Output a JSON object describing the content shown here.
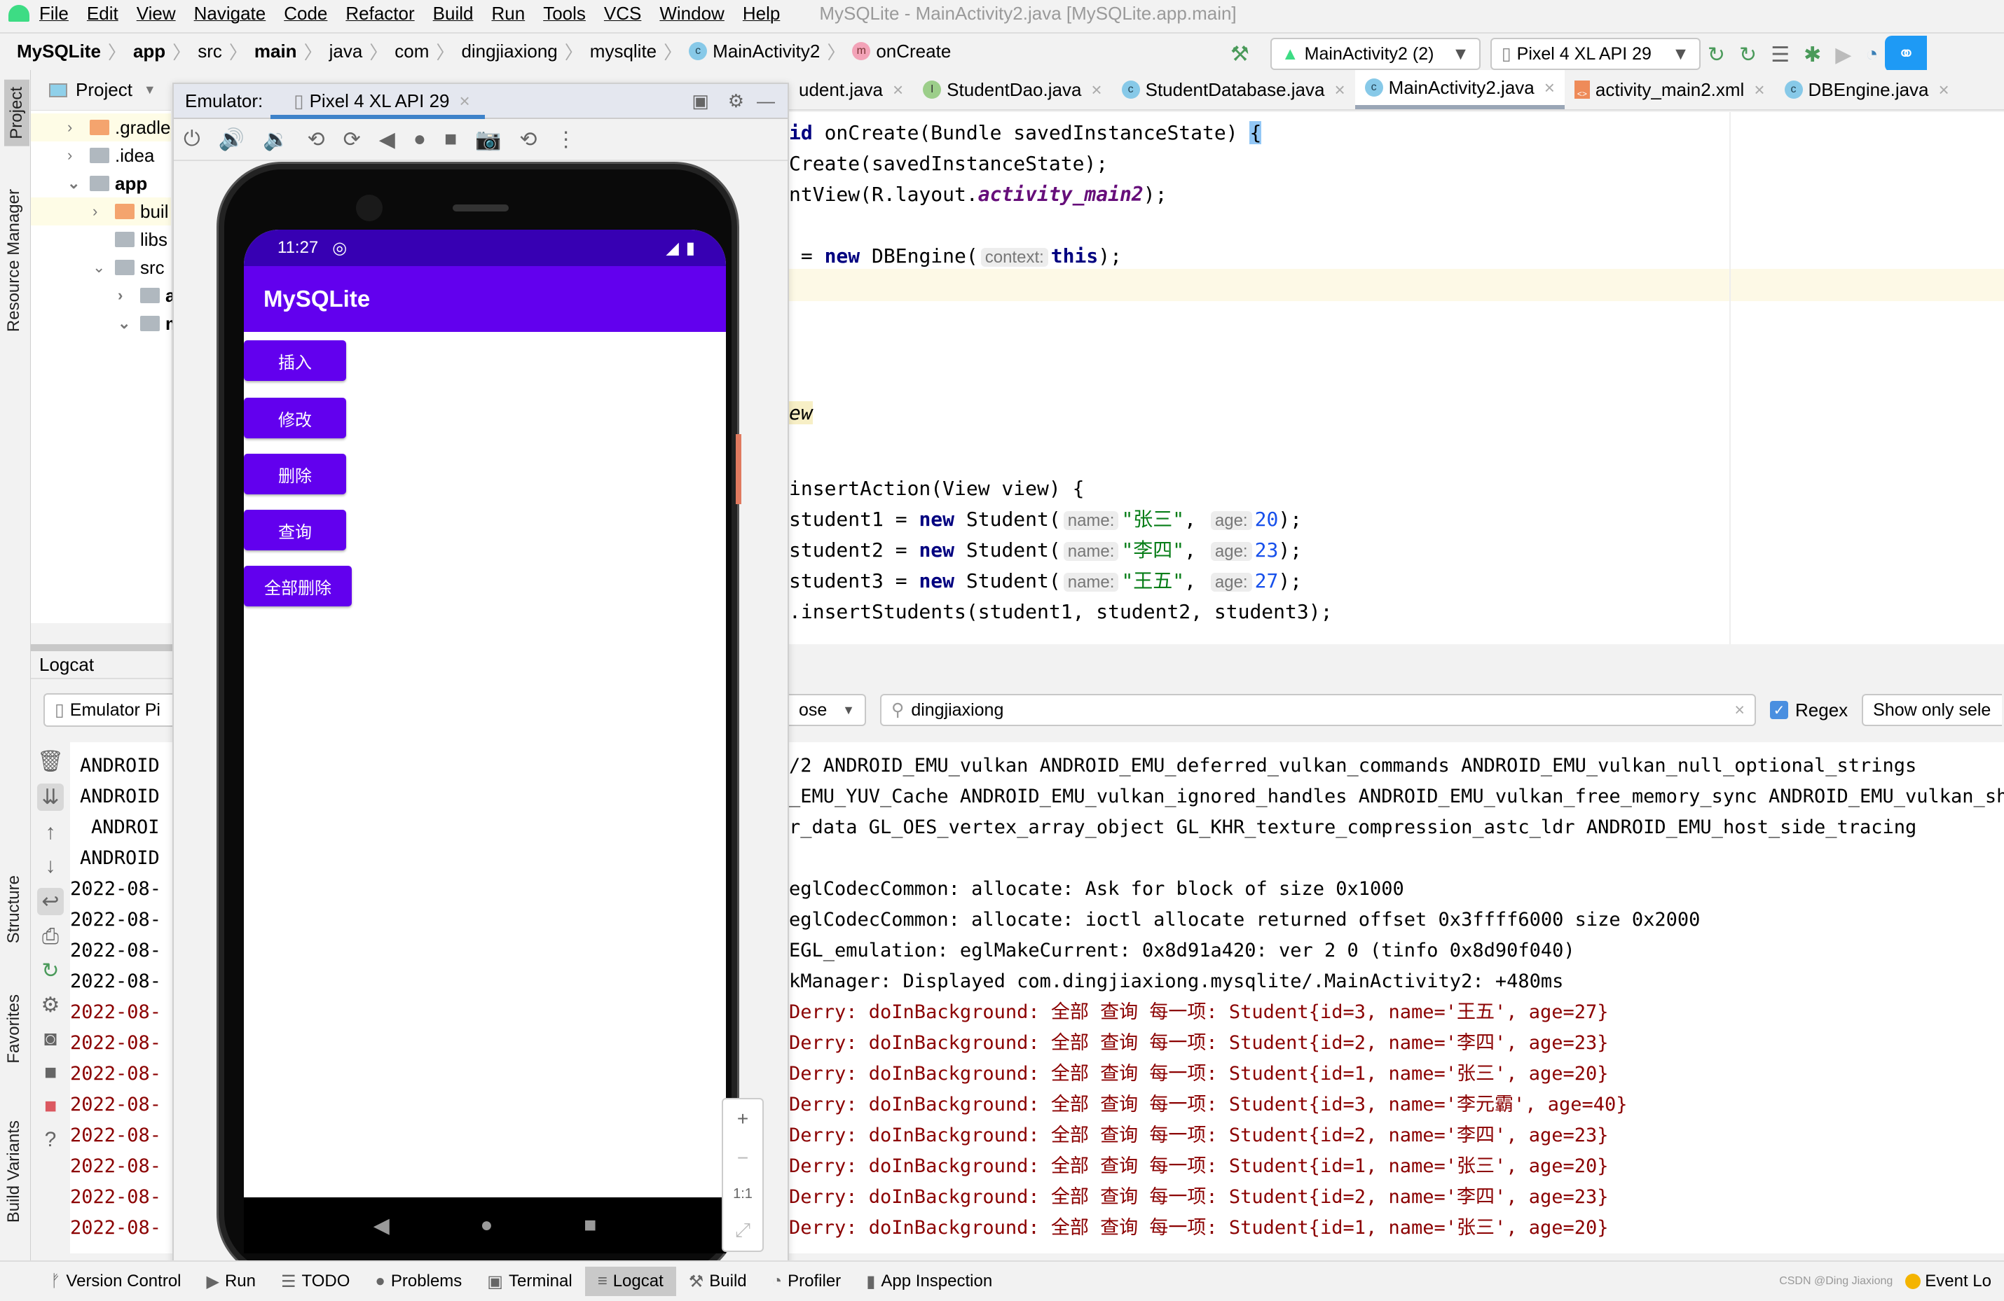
{
  "menubar": {
    "items": [
      "File",
      "Edit",
      "View",
      "Navigate",
      "Code",
      "Refactor",
      "Build",
      "Run",
      "Tools",
      "VCS",
      "Window",
      "Help"
    ],
    "window_title": "MySQLite - MainActivity2.java [MySQLite.app.main]"
  },
  "breadcrumb": {
    "items": [
      "MySQLite",
      "app",
      "src",
      "main",
      "java",
      "com",
      "dingjiaxiong",
      "mysqlite",
      "MainActivity2",
      "onCreate"
    ]
  },
  "toolbar": {
    "run_config": "MainActivity2 (2)",
    "device": "Pixel 4 XL API 29"
  },
  "sidebar_left": {
    "tabs": [
      "Project",
      "Resource Manager",
      "Structure",
      "Favorites",
      "Build Variants"
    ]
  },
  "project_panel": {
    "title": "Project",
    "tree": [
      ".gradle",
      ".idea",
      "app",
      "buil",
      "libs",
      "src",
      "a",
      "m"
    ]
  },
  "emulator": {
    "label": "Emulator:",
    "tab": "Pixel 4 XL API 29",
    "phone": {
      "time": "11:27",
      "app_title": "MySQLite",
      "buttons": [
        "插入",
        "修改",
        "删除",
        "查询",
        "全部删除"
      ]
    },
    "zoom_controls": [
      "+",
      "−",
      "1:1",
      "⤢"
    ]
  },
  "editor_tabs": [
    {
      "label": "udent.java",
      "icon": "C",
      "active": false
    },
    {
      "label": "StudentDao.java",
      "icon": "I",
      "active": false
    },
    {
      "label": "StudentDatabase.java",
      "icon": "C",
      "active": false
    },
    {
      "label": "MainActivity2.java",
      "icon": "C",
      "active": true
    },
    {
      "label": "activity_main2.xml",
      "icon": "xml",
      "active": false
    },
    {
      "label": "DBEngine.java",
      "icon": "C",
      "active": false
    }
  ],
  "code": {
    "l1": {
      "kw": "id",
      "rest": " onCreate(Bundle savedInstanceState) ",
      "brace": "{"
    },
    "l2": "Create(savedInstanceState);",
    "l3": {
      "a": "ntView(R.layout.",
      "it": "activity_main2",
      "b": ");"
    },
    "l4": {
      "a": " = ",
      "kw": "new",
      "b": " DBEngine(",
      "hint": "context:",
      "kw2": "this",
      "c": ");"
    },
    "l5": "ew",
    "l6": "insertAction(View view) {",
    "students": [
      {
        "var": "student1",
        "name": "\"张三\"",
        "age": "20"
      },
      {
        "var": "student2",
        "name": "\"李四\"",
        "age": "23"
      },
      {
        "var": "student3",
        "name": "\"王五\"",
        "age": "27"
      }
    ],
    "kw_new": "new",
    "cls": " Student(",
    "hint_name": "name:",
    "hint_age": "age:",
    "l10": ".insertStudents(student1, student2, student3);"
  },
  "logcat": {
    "title": "Logcat",
    "device_select": "Emulator Pi",
    "level_select": "ose",
    "search_value": "dingjiaxiong",
    "regex_label": "Regex",
    "regex_checked": true,
    "show_only": "Show only sele",
    "left_col": [
      "ANDROID",
      "ANDROID",
      "ANDROI",
      "ANDROID",
      "2022-08-",
      "2022-08-",
      "2022-08-",
      "2022-08-",
      "2022-08-",
      "2022-08-",
      "2022-08-",
      "2022-08-",
      "2022-08-",
      "2022-08-",
      "2022-08-",
      "2022-08-"
    ],
    "lines": [
      {
        "t": "/2 ANDROID_EMU_vulkan ANDROID_EMU_deferred_vulkan_commands ANDROID_EMU_vulkan_null_optional_strings",
        "err": false
      },
      {
        "t": "_EMU_YUV_Cache ANDROID_EMU_vulkan_ignored_handles ANDROID_EMU_vulkan_free_memory_sync ANDROID_EMU_vulkan_shad",
        "err": false
      },
      {
        "t": "r_data GL_OES_vertex_array_object GL_KHR_texture_compression_astc_ldr ANDROID_EMU_host_side_tracing",
        "err": false
      },
      {
        "t": "",
        "err": false
      },
      {
        "t": "eglCodecCommon: allocate: Ask for block of size 0x1000",
        "err": false
      },
      {
        "t": "eglCodecCommon: allocate: ioctl allocate returned offset 0x3ffff6000 size 0x2000",
        "err": false
      },
      {
        "t": "EGL_emulation: eglMakeCurrent: 0x8d91a420: ver 2 0 (tinfo 0x8d90f040)",
        "err": false
      },
      {
        "t": "kManager: Displayed com.dingjiaxiong.mysqlite/.MainActivity2: +480ms",
        "err": false
      },
      {
        "t": "Derry: doInBackground: 全部 查询 每一项: Student{id=3, name='王五', age=27}",
        "err": true
      },
      {
        "t": "Derry: doInBackground: 全部 查询 每一项: Student{id=2, name='李四', age=23}",
        "err": true
      },
      {
        "t": "Derry: doInBackground: 全部 查询 每一项: Student{id=1, name='张三', age=20}",
        "err": true
      },
      {
        "t": "Derry: doInBackground: 全部 查询 每一项: Student{id=3, name='李元霸', age=40}",
        "err": true
      },
      {
        "t": "Derry: doInBackground: 全部 查询 每一项: Student{id=2, name='李四', age=23}",
        "err": true
      },
      {
        "t": "Derry: doInBackground: 全部 查询 每一项: Student{id=1, name='张三', age=20}",
        "err": true
      },
      {
        "t": "Derry: doInBackground: 全部 查询 每一项: Student{id=2, name='李四', age=23}",
        "err": true
      },
      {
        "t": "Derry: doInBackground: 全部 查询 每一项: Student{id=1, name='张三', age=20}",
        "err": true
      }
    ]
  },
  "bottom_bar": {
    "tabs": [
      "Version Control",
      "Run",
      "TODO",
      "Problems",
      "Terminal",
      "Logcat",
      "Build",
      "Profiler",
      "App Inspection"
    ],
    "active": "Logcat",
    "right": "Event Lo",
    "watermark": "CSDN @Ding Jiaxiong"
  },
  "colors": {
    "accent_purple": "#6200ee",
    "status_purple": "#3700b3",
    "error_text": "#8b0000"
  }
}
